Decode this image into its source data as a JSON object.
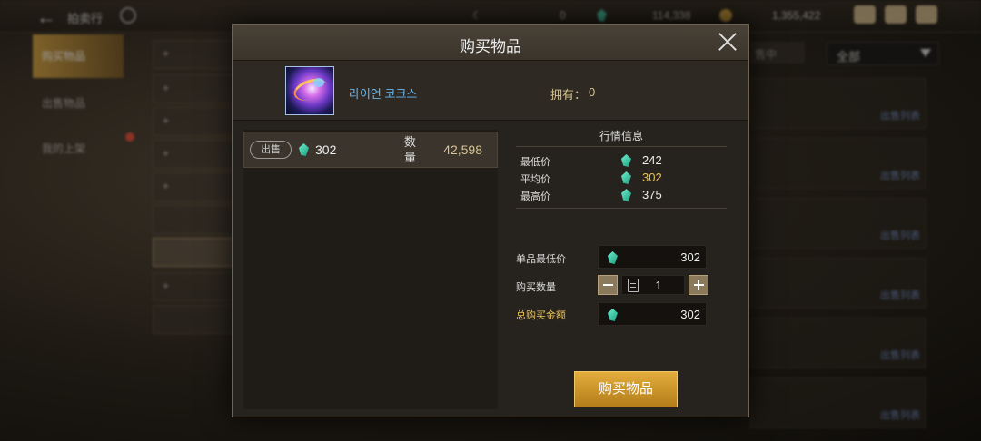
{
  "topbar": {
    "back_label": "拍卖行",
    "currency_moon": "0",
    "currency_gem": "114,338",
    "currency_gold": "1,355,422"
  },
  "sidebar": {
    "items": [
      {
        "label": "购买物品"
      },
      {
        "label": "出售物品"
      },
      {
        "label": "我的上架"
      }
    ]
  },
  "background": {
    "right_header": "售中",
    "filter_value": "全部",
    "row_link": "出售列表"
  },
  "modal": {
    "title": "购买物品",
    "item": {
      "name": "라이언 코크스",
      "owned_label": "拥有：",
      "owned_value": "0"
    },
    "listing": {
      "badge": "出售",
      "price": "302",
      "qty_label": "数量",
      "qty_value": "42,598"
    },
    "market": {
      "title": "行情信息",
      "stats": [
        {
          "label": "最低价",
          "value": "242"
        },
        {
          "label": "平均价",
          "value": "302"
        },
        {
          "label": "最高价",
          "value": "375"
        }
      ]
    },
    "form": {
      "unit_min_label": "单品最低价",
      "unit_min_value": "302",
      "qty_label": "购买数量",
      "qty_value": "1",
      "total_label": "总购买金额",
      "total_value": "302"
    },
    "buy_button": "购买物品"
  },
  "colors": {
    "accent_gold": "#e3ad3c",
    "gem_teal": "#3fc6a6",
    "item_name_blue": "#69b8f0",
    "avg_price": "#e8c35a"
  }
}
